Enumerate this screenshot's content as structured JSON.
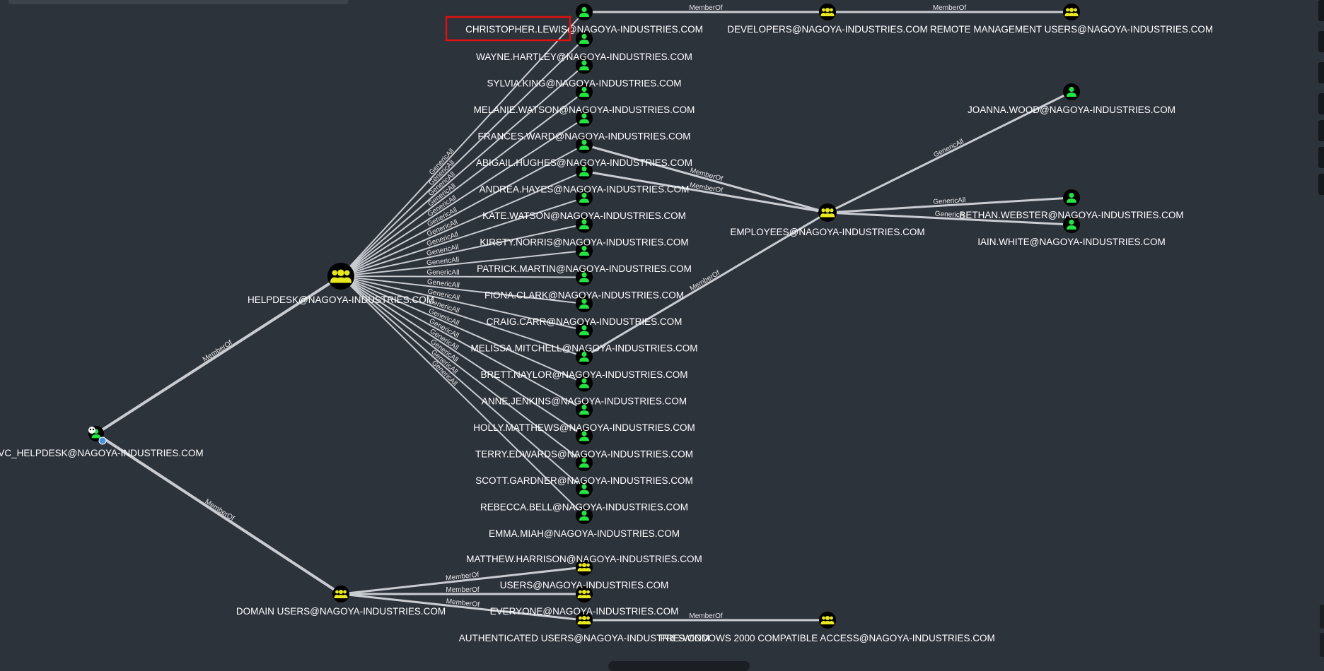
{
  "edge_labels": {
    "member_of": "MemberOf",
    "generic_all": "GenericAll",
    "generic_all_truncated": "GenericA"
  },
  "nodes": {
    "svc_helpdesk": "SVC_HELPDESK@NAGOYA-INDUSTRIES.COM",
    "helpdesk": "HELPDESK@NAGOYA-INDUSTRIES.COM",
    "domain_users": "DOMAIN USERS@NAGOYA-INDUSTRIES.COM",
    "christopher_lewis": "CHRISTOPHER.LEWIS@NAGOYA-INDUSTRIES.COM",
    "wayne_hartley": "WAYNE.HARTLEY@NAGOYA-INDUSTRIES.COM",
    "sylvia_king": "SYLVIA.KING@NAGOYA-INDUSTRIES.COM",
    "melanie_watson": "MELANIE.WATSON@NAGOYA-INDUSTRIES.COM",
    "frances_ward": "FRANCES.WARD@NAGOYA-INDUSTRIES.COM",
    "abigail_hughes": "ABIGAIL.HUGHES@NAGOYA-INDUSTRIES.COM",
    "andrea_hayes": "ANDREA.HAYES@NAGOYA-INDUSTRIES.COM",
    "kate_watson": "KATE.WATSON@NAGOYA-INDUSTRIES.COM",
    "kirsty_norris": "KIRSTY.NORRIS@NAGOYA-INDUSTRIES.COM",
    "patrick_martin": "PATRICK.MARTIN@NAGOYA-INDUSTRIES.COM",
    "fiona_clark": "FIONA.CLARK@NAGOYA-INDUSTRIES.COM",
    "craig_carr": "CRAIG.CARR@NAGOYA-INDUSTRIES.COM",
    "melissa_mitchell": "MELISSA.MITCHELL@NAGOYA-INDUSTRIES.COM",
    "brett_naylor": "BRETT.NAYLOR@NAGOYA-INDUSTRIES.COM",
    "anne_jenkins": "ANNE.JENKINS@NAGOYA-INDUSTRIES.COM",
    "holly_matthews": "HOLLY.MATTHEWS@NAGOYA-INDUSTRIES.COM",
    "terry_edwards": "TERRY.EDWARDS@NAGOYA-INDUSTRIES.COM",
    "scott_gardner": "SCOTT.GARDNER@NAGOYA-INDUSTRIES.COM",
    "rebecca_bell": "REBECCA.BELL@NAGOYA-INDUSTRIES.COM",
    "emma_miah": "EMMA.MIAH@NAGOYA-INDUSTRIES.COM",
    "matthew_harrison": "MATTHEW.HARRISON@NAGOYA-INDUSTRIES.COM",
    "users": "USERS@NAGOYA-INDUSTRIES.COM",
    "everyone": "EVERYONE@NAGOYA-INDUSTRIES.COM",
    "authenticated_users": "AUTHENTICATED USERS@NAGOYA-INDUSTRIES.COM",
    "pre_windows_2000": "PRE-WINDOWS 2000 COMPATIBLE ACCESS@NAGOYA-INDUSTRIES.COM",
    "developers": "DEVELOPERS@NAGOYA-INDUSTRIES.COM",
    "remote_management_users": "REMOTE MANAGEMENT USERS@NAGOYA-INDUSTRIES.COM",
    "employees": "EMPLOYEES@NAGOYA-INDUSTRIES.COM",
    "joanna_wood": "JOANNA.WOOD@NAGOYA-INDUSTRIES.COM",
    "bethan_webster": "BETHAN.WEBSTER@NAGOYA-INDUSTRIES.COM",
    "iain_white": "IAIN.WHITE@NAGOYA-INDUSTRIES.COM"
  },
  "colors": {
    "background": "#2d333b",
    "edge": "#c9ccd1",
    "user_icon": "#22e544",
    "group_icon": "#e8e81f",
    "node_disc": "#000000",
    "highlight_box": "#e01010",
    "owned_badge": "#4a90e2"
  },
  "icons": {
    "user": "user-icon",
    "group": "group-icon",
    "owned": "skull-icon",
    "badge": "high-value-badge-icon"
  }
}
